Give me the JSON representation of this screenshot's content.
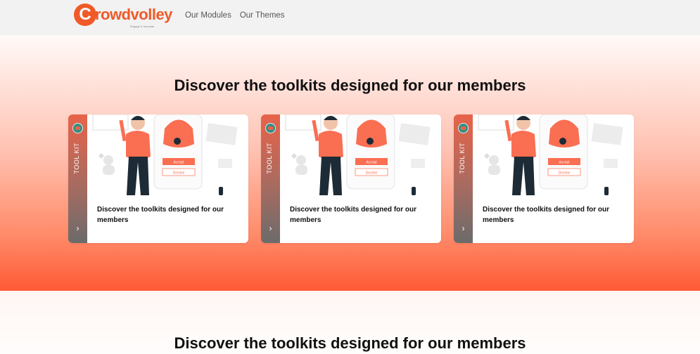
{
  "brand": {
    "name": "Crowdvolley",
    "logo_letter": "C",
    "logo_rest": "rowdvolley",
    "tagline": "Engage & Innovate",
    "color": "#f05a28"
  },
  "nav": {
    "items": [
      {
        "label": "Our Modules"
      },
      {
        "label": "Our Themes"
      }
    ]
  },
  "hero": {
    "title": "Discover the toolkits designed for our members"
  },
  "cards": [
    {
      "tag": "TOOL KIT",
      "title": "Discover the toolkits designed for our members",
      "button_primary": "Accept",
      "button_secondary": "Decline",
      "arrow_icon": "chevron-right-icon"
    },
    {
      "tag": "TOOL KIT",
      "title": "Discover the toolkits designed for our members",
      "button_primary": "Accept",
      "button_secondary": "Decline",
      "arrow_icon": "chevron-right-icon"
    },
    {
      "tag": "TOOL KIT",
      "title": "Discover the toolkits designed for our members",
      "button_primary": "Accept",
      "button_secondary": "Decline",
      "arrow_icon": "chevron-right-icon"
    }
  ],
  "section2": {
    "title": "Discover the toolkits designed for our members"
  },
  "colors": {
    "accent": "#f05a28",
    "illustration": "#fa6e52",
    "dark": "#1d2b36"
  }
}
